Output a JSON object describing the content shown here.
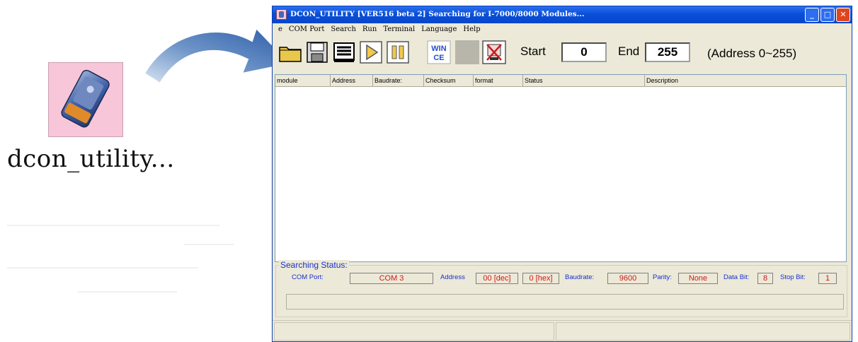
{
  "desktop": {
    "icon_name": "dcon-utility-app-icon",
    "label": "dcon_utility..."
  },
  "window": {
    "title": "DCON_UTILITY [VER516 beta 2] Searching for I-7000/8000 Modules...",
    "controls": {
      "minimize": "_",
      "maximize": "□",
      "close": "✕"
    }
  },
  "menu": [
    "e",
    "COM Port",
    "Search",
    "Run",
    "Terminal",
    "Language",
    "Help"
  ],
  "toolbar": {
    "buttons": [
      "open-folder-icon",
      "save-disk-icon",
      "print-icon",
      "run-play-icon",
      "pause-icon",
      "wince-icon",
      "blank-icon",
      "stop-search-icon"
    ],
    "wince_text": [
      "WIN",
      "CE"
    ],
    "start_label": "Start",
    "start_value": "0",
    "end_label": "End",
    "end_value": "255",
    "range_text": "(Address 0~255)"
  },
  "table": {
    "columns": [
      "module",
      "Address",
      "Baudrate:",
      "Checksum",
      "format",
      "Status",
      "Description"
    ],
    "rows": []
  },
  "searching_status": {
    "legend": "Searching Status:",
    "com_port_label": "COM Port:",
    "com_port_value": "COM 3",
    "address_label": "Address",
    "address_dec": "00 [dec]",
    "address_hex": "0 [hex]",
    "baudrate_label": "Baudrate:",
    "baudrate_value": "9600",
    "parity_label": "Parity:",
    "parity_value": "None",
    "data_bit_label": "Data Bit:",
    "data_bit_value": "8",
    "stop_bit_label": "Stop Bit:",
    "stop_bit_value": "1"
  },
  "colors": {
    "title_bar": "#0a4fd9",
    "window_bg": "#ece9d8",
    "status_label": "#1a2fd0",
    "status_value": "#d01a1a",
    "arrow": "#2b5ca8"
  }
}
